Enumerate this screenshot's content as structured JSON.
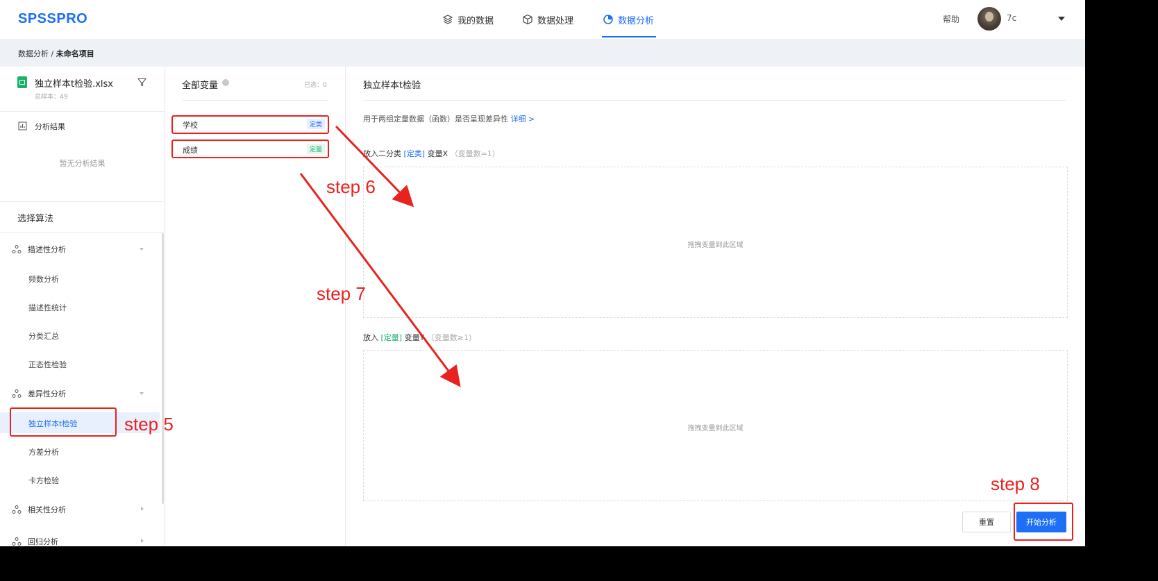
{
  "header": {
    "logo": "SPSSPRO",
    "nav": [
      {
        "label": "我的数据",
        "icon": "layers-icon"
      },
      {
        "label": "数据处理",
        "icon": "cube-icon"
      },
      {
        "label": "数据分析",
        "icon": "pie-chart-icon",
        "active": true
      }
    ],
    "help": "帮助",
    "username": "7c"
  },
  "breadcrumb": {
    "root": "数据分析",
    "separator": " / ",
    "current": "未命名项目"
  },
  "sidebar": {
    "file_name": "独立样本t检验.xlsx",
    "sample_count": "总样本：49",
    "results_title": "分析结果",
    "results_empty": "暂无分析结果",
    "algo_title": "选择算法",
    "groups": [
      {
        "label": "描述性分析",
        "expanded": true,
        "items": [
          "频数分析",
          "描述性统计",
          "分类汇总",
          "正态性检验"
        ]
      },
      {
        "label": "差异性分析",
        "expanded": true,
        "items": [
          "独立样本t检验",
          "方差分析",
          "卡方检验"
        ]
      },
      {
        "label": "相关性分析",
        "expanded": false,
        "items": []
      },
      {
        "label": "回归分析",
        "expanded": false,
        "items": []
      }
    ],
    "active_item": "独立样本t检验"
  },
  "variables": {
    "title": "全部变量",
    "selected": "已选：0",
    "items": [
      {
        "name": "学校",
        "tag": "定类",
        "tag_color": "#1e6ff5"
      },
      {
        "name": "成绩",
        "tag": "定量",
        "tag_color": "#17b26a"
      }
    ]
  },
  "panel": {
    "title": "独立样本t检验",
    "description": "用于两组定量数据（函数）是否呈现差异性",
    "detail_link": "详细 >",
    "zone_x": {
      "prefix": "放入二分类 ",
      "type": "[定类]",
      "suffix": " 变量X ",
      "hint": "（变量数=1）",
      "placeholder": "拖拽变量到此区域"
    },
    "zone_y": {
      "prefix": "放入 ",
      "type": "[定量]",
      "suffix": " 变量Y ",
      "hint": "（变量数≥1）",
      "placeholder": "拖拽变量到此区域"
    },
    "reset_label": "重置",
    "start_label": "开始分析"
  },
  "annotations": {
    "step5": "step 5",
    "step6": "step 6",
    "step7": "step 7",
    "step8": "step 8",
    "color": "#e8221f"
  }
}
